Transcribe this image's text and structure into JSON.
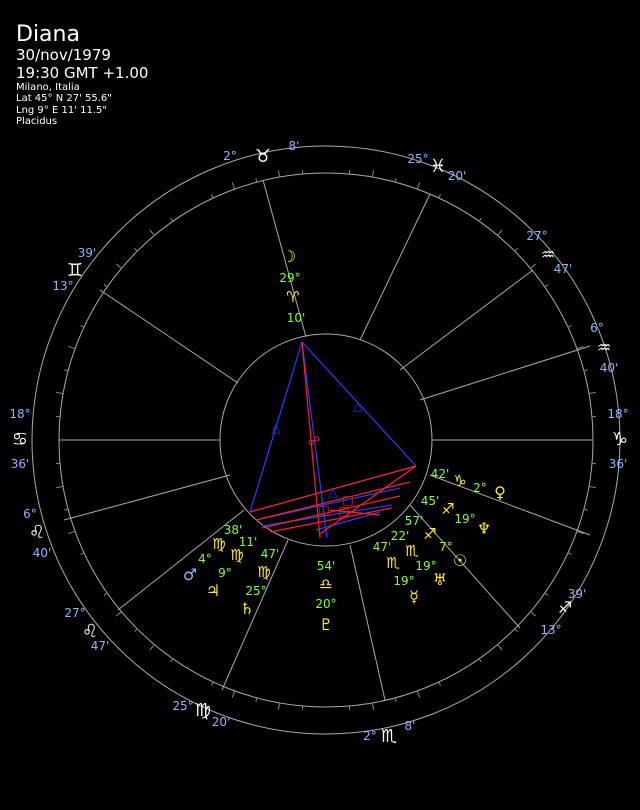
{
  "header": {
    "name": "Diana",
    "date": "30/nov/1979",
    "time": "19:30 GMT +1.00",
    "place": "Milano, Italia",
    "lat": "Lat 45° N 27' 55.6\"",
    "lng": "Lng 9° E 11' 11.5\"",
    "house_system": "Placidus"
  },
  "colors": {
    "background": "#000000",
    "wheel": "#aaaaaa",
    "cusp_label": "#8fb4ff",
    "planet_degree": "#7fff3a",
    "planet_glyph": "#ffea2a",
    "planet_minute": "#7fff3a",
    "aspect_hard": "#ff2020",
    "aspect_soft": "#2040ff"
  },
  "cusps": [
    {
      "deg": "2°",
      "glyph": "♉",
      "min": "8'"
    },
    {
      "deg": "25°",
      "glyph": "♓",
      "min": "20'"
    },
    {
      "deg": "27°",
      "glyph": "♒",
      "min": "47'"
    },
    {
      "deg": "6°",
      "glyph": "♒",
      "min": "40'"
    },
    {
      "deg": "18°",
      "glyph": "♑",
      "min": "36'"
    },
    {
      "deg": "6°",
      "glyph": "♑",
      "min": "40'"
    },
    {
      "deg": "39'",
      "glyph": "♐",
      "min": "13°"
    },
    {
      "deg": "2°",
      "glyph": "♏",
      "min": "8'"
    },
    {
      "deg": "25°",
      "glyph": "♍",
      "min": "20'"
    },
    {
      "deg": "27°",
      "glyph": "♌",
      "min": "47'"
    },
    {
      "deg": "6°",
      "glyph": "♌",
      "min": "40'"
    },
    {
      "deg": "18°",
      "glyph": "♋",
      "min": "36'"
    },
    {
      "deg": "39'",
      "glyph": "♊",
      "min": "13°"
    }
  ],
  "planets": [
    {
      "glyph": "☽",
      "deg": "29°",
      "sign": "♈",
      "min": "10'"
    },
    {
      "glyph": "♀",
      "deg": "2°",
      "sign": "♑",
      "min": "42'"
    },
    {
      "glyph": "♆",
      "deg": "19°",
      "sign": "♐",
      "min": "45'"
    },
    {
      "glyph": "☉",
      "deg": "7°",
      "sign": "♐",
      "min": "57'"
    },
    {
      "glyph": "☿",
      "deg": "19°",
      "sign": "♏",
      "min": "22'"
    },
    {
      "glyph": "♅",
      "deg": "22°",
      "sign": "♏",
      "min": "47'"
    },
    {
      "glyph": "♇",
      "deg": "20°",
      "sign": "♎",
      "min": "54'"
    },
    {
      "glyph": "♄",
      "deg": "25°",
      "sign": "♍",
      "min": "47'"
    },
    {
      "glyph": "♃",
      "deg": "9°",
      "sign": "♍",
      "min": "11'"
    },
    {
      "glyph": "♂",
      "deg": "4°",
      "sign": "♍",
      "min": "38'"
    }
  ],
  "aspect_glyphs": {
    "trine": "△",
    "opposition": "☍",
    "square": "□"
  }
}
